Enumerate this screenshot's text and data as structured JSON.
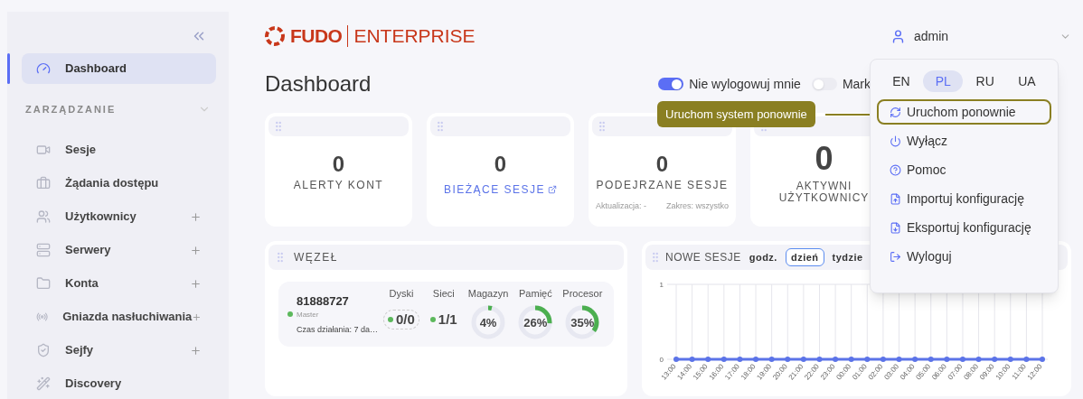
{
  "sidebar": {
    "items": [
      {
        "label": "Dashboard",
        "selected": true,
        "expandable": false
      }
    ],
    "section": {
      "title": "ZARZĄDZANIE",
      "expanded": true
    },
    "section_items": [
      {
        "label": "Sesje",
        "selected": false,
        "expandable": false
      },
      {
        "label": "Żądania dostępu",
        "selected": false,
        "expandable": false
      },
      {
        "label": "Użytkownicy",
        "selected": false,
        "expandable": true
      },
      {
        "label": "Serwery",
        "selected": false,
        "expandable": true
      },
      {
        "label": "Konta",
        "selected": false,
        "expandable": true
      },
      {
        "label": "Gniazda nasłuchiwania",
        "selected": false,
        "expandable": true
      },
      {
        "label": "Sejfy",
        "selected": false,
        "expandable": true
      },
      {
        "label": "Discovery",
        "selected": false,
        "expandable": false
      }
    ]
  },
  "header": {
    "logo": {
      "brand": "FUDO",
      "product": "ENTERPRISE"
    },
    "user": "admin"
  },
  "page_title": "Dashboard",
  "toggles": [
    {
      "label": "Nie wylogowuj mnie",
      "on": true
    },
    {
      "label": "Mark",
      "on": false
    }
  ],
  "cards": [
    {
      "value": "0",
      "label": "ALERTY KONT",
      "kind": "plain"
    },
    {
      "value": "0",
      "label": "BIEŻĄCE SESJE",
      "kind": "link"
    },
    {
      "value": "0",
      "label": "PODEJRZANE SESJE",
      "kind": "footer",
      "footer": [
        "Aktualizacja: -",
        "Zakres: wszystko"
      ]
    },
    {
      "value": "0",
      "label": "AKTYWNI UŻYTKOWNICY",
      "kind": "large"
    }
  ],
  "node_panel": {
    "title": "WĘZEŁ",
    "node": {
      "name": "81888727",
      "role": "Master",
      "uptime": "Czas działania: 7 da…",
      "stats": [
        {
          "label": "Dyski",
          "value": "0/0",
          "kind": "pill"
        },
        {
          "label": "Sieci",
          "value": "1/1",
          "kind": "count"
        },
        {
          "label": "Magazyn",
          "value": "4%",
          "kind": "gauge",
          "level": 0.04
        },
        {
          "label": "Pamięć",
          "value": "26%",
          "kind": "gauge",
          "level": 0.26
        },
        {
          "label": "Procesor",
          "value": "35%",
          "kind": "gauge",
          "level": 0.35
        }
      ]
    }
  },
  "sessions_panel": {
    "title": "NOWE SESJE",
    "ranges": [
      {
        "label": "godz.",
        "selected": false
      },
      {
        "label": "dzień",
        "selected": true
      },
      {
        "label": "tydzie",
        "selected": false
      }
    ],
    "chart_data": {
      "type": "line",
      "categories": [
        "13:00",
        "14:00",
        "15:00",
        "16:00",
        "17:00",
        "18:00",
        "19:00",
        "20:00",
        "21:00",
        "22:00",
        "23:00",
        "00:00",
        "01:00",
        "02:00",
        "03:00",
        "04:00",
        "05:00",
        "06:00",
        "07:00",
        "08:00",
        "09:00",
        "10:00",
        "11:00",
        "12:00"
      ],
      "series": [
        {
          "color": "#5b73e8",
          "marker": "circle",
          "values": [
            0,
            0,
            0,
            0,
            0,
            0,
            0,
            0,
            0,
            0,
            0,
            0,
            0,
            0,
            0,
            0,
            0,
            0,
            0,
            0,
            0,
            0,
            0,
            0
          ]
        }
      ],
      "ylim": [
        0,
        1
      ],
      "yticks": [
        0,
        1
      ],
      "grid": true
    }
  },
  "user_menu": {
    "languages": [
      {
        "label": "EN",
        "selected": false
      },
      {
        "label": "PL",
        "selected": true
      },
      {
        "label": "RU",
        "selected": false
      },
      {
        "label": "UA",
        "selected": false
      }
    ],
    "items": [
      {
        "label": "Uruchom ponownie",
        "highlighted": true
      },
      {
        "label": "Wyłącz",
        "highlighted": false
      },
      {
        "label": "Pomoc",
        "highlighted": false
      },
      {
        "label": "Importuj konfigurację",
        "highlighted": false
      },
      {
        "label": "Eksportuj konfigurację",
        "highlighted": false
      },
      {
        "label": "Wyloguj",
        "highlighted": false
      }
    ]
  },
  "callout": {
    "text": "Uruchom system ponownie"
  }
}
